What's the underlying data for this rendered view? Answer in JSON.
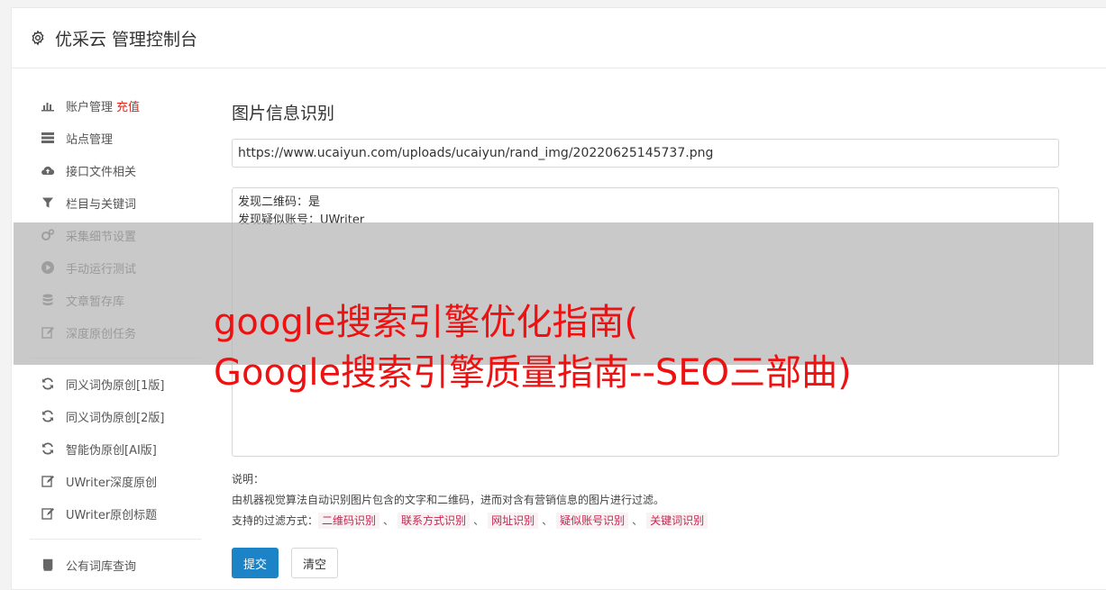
{
  "header": {
    "title": "优采云 管理控制台",
    "icon": "gear-icon"
  },
  "sidebar": {
    "group1": [
      {
        "label": "账户管理",
        "badge": "充值",
        "icon": "bar-chart-icon"
      },
      {
        "label": "站点管理",
        "icon": "server-icon"
      },
      {
        "label": "接口文件相关",
        "icon": "cloud-upload-icon"
      },
      {
        "label": "栏目与关键词",
        "icon": "filter-icon"
      },
      {
        "label": "采集细节设置",
        "icon": "gears-icon"
      },
      {
        "label": "手动运行测试",
        "icon": "play-circle-icon"
      },
      {
        "label": "文章暂存库",
        "icon": "database-icon"
      },
      {
        "label": "深度原创任务",
        "icon": "edit-icon"
      }
    ],
    "group2": [
      {
        "label": "同义词伪原创[1版]",
        "icon": "refresh-icon"
      },
      {
        "label": "同义词伪原创[2版]",
        "icon": "refresh-icon"
      },
      {
        "label": "智能伪原创[AI版]",
        "icon": "refresh-icon"
      },
      {
        "label": "UWriter深度原创",
        "icon": "edit-icon"
      },
      {
        "label": "UWriter原创标题",
        "icon": "edit-icon"
      }
    ],
    "group3": [
      {
        "label": "公有词库查询",
        "icon": "book-icon"
      }
    ]
  },
  "main": {
    "title": "图片信息识别",
    "url_value": "https://www.ucaiyun.com/uploads/ucaiyun/rand_img/20220625145737.png",
    "result_lines": [
      "发现二维码：是",
      "发现疑似账号：UWriter"
    ],
    "notes": {
      "label": "说明：",
      "desc": "由机器视觉算法自动识别图片包含的文字和二维码，进而对含有营销信息的图片进行过滤。",
      "filter_label": "支持的过滤方式：",
      "separator": "、",
      "tags": [
        "二维码识别",
        "联系方式识别",
        "网址识别",
        "疑似账号识别",
        "关键词识别"
      ]
    },
    "submit_label": "提交",
    "clear_label": "清空"
  },
  "overlay": {
    "line1": "google搜索引擎优化指南(",
    "line2": "Google搜索引擎质量指南--SEO三部曲)"
  },
  "colors": {
    "primary": "#1c84c6",
    "danger": "#e1251b",
    "overlay_text": "#ee1111"
  }
}
